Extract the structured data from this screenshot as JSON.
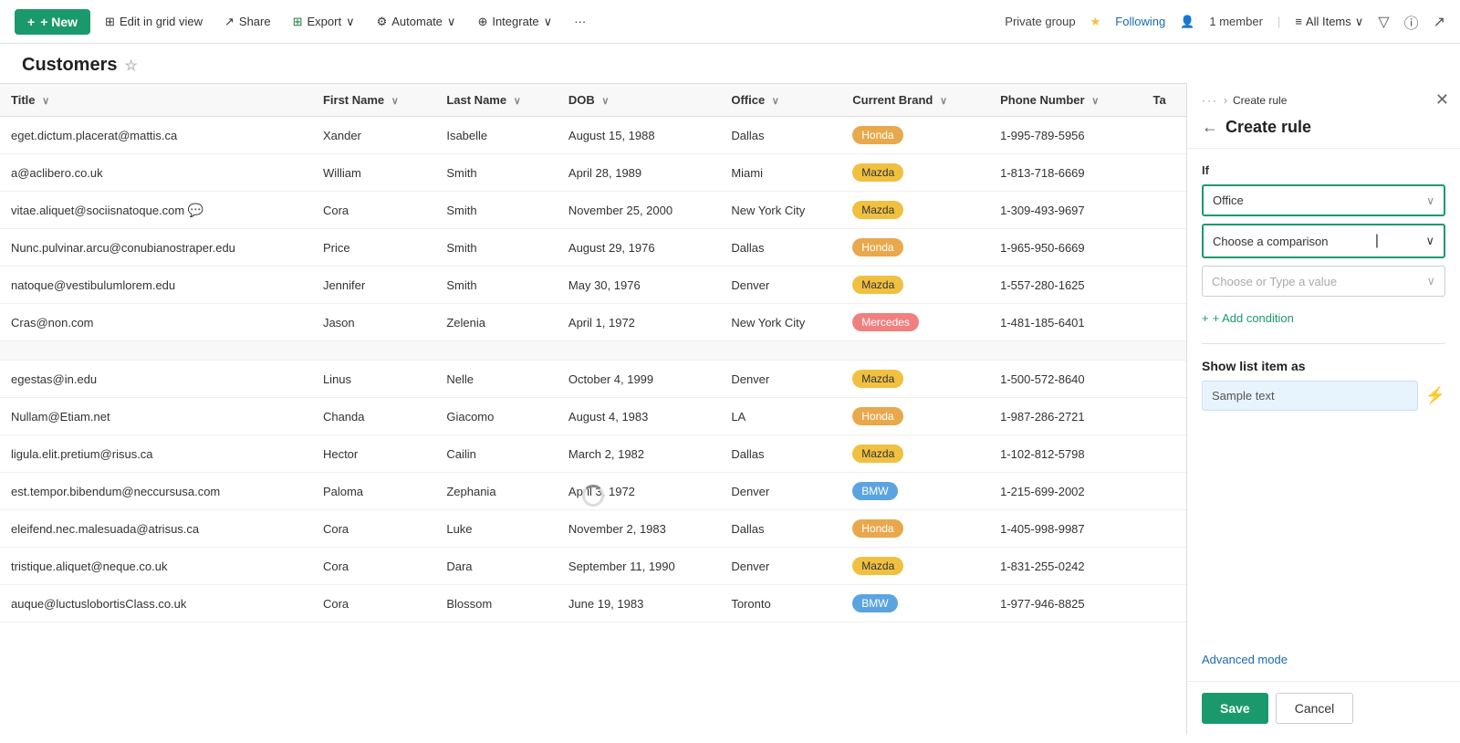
{
  "topbar": {
    "new_label": "+ New",
    "edit_grid_label": "Edit in grid view",
    "share_label": "Share",
    "export_label": "Export",
    "automate_label": "Automate",
    "integrate_label": "Integrate",
    "more_label": "···",
    "private_group_label": "Private group",
    "following_label": "Following",
    "member_label": "1 member",
    "all_items_label": "All Items",
    "filter_icon": "≡"
  },
  "page": {
    "title": "Customers"
  },
  "table": {
    "columns": [
      "Title",
      "First Name",
      "Last Name",
      "DOB",
      "Office",
      "Current Brand",
      "Phone Number",
      "Ta"
    ],
    "rows": [
      {
        "title": "eget.dictum.placerat@mattis.ca",
        "first_name": "Xander",
        "last_name": "Isabelle",
        "dob": "August 15, 1988",
        "office": "Dallas",
        "brand": "Honda",
        "brand_class": "brand-honda",
        "phone": "1-995-789-5956",
        "has_chat": false
      },
      {
        "title": "a@aclibero.co.uk",
        "first_name": "William",
        "last_name": "Smith",
        "dob": "April 28, 1989",
        "office": "Miami",
        "brand": "Mazda",
        "brand_class": "brand-mazda",
        "phone": "1-813-718-6669",
        "has_chat": false
      },
      {
        "title": "vitae.aliquet@sociisnatoque.com",
        "first_name": "Cora",
        "last_name": "Smith",
        "dob": "November 25, 2000",
        "office": "New York City",
        "brand": "Mazda",
        "brand_class": "brand-mazda",
        "phone": "1-309-493-9697",
        "has_chat": true
      },
      {
        "title": "Nunc.pulvinar.arcu@conubianostraper.edu",
        "first_name": "Price",
        "last_name": "Smith",
        "dob": "August 29, 1976",
        "office": "Dallas",
        "brand": "Honda",
        "brand_class": "brand-honda",
        "phone": "1-965-950-6669",
        "has_chat": false
      },
      {
        "title": "natoque@vestibulumlorem.edu",
        "first_name": "Jennifer",
        "last_name": "Smith",
        "dob": "May 30, 1976",
        "office": "Denver",
        "brand": "Mazda",
        "brand_class": "brand-mazda",
        "phone": "1-557-280-1625",
        "has_chat": false
      },
      {
        "title": "Cras@non.com",
        "first_name": "Jason",
        "last_name": "Zelenia",
        "dob": "April 1, 1972",
        "office": "New York City",
        "brand": "Mercedes",
        "brand_class": "brand-mercedes",
        "phone": "1-481-185-6401",
        "has_chat": false
      },
      {
        "separator": true
      },
      {
        "title": "egestas@in.edu",
        "first_name": "Linus",
        "last_name": "Nelle",
        "dob": "October 4, 1999",
        "office": "Denver",
        "brand": "Mazda",
        "brand_class": "brand-mazda",
        "phone": "1-500-572-8640",
        "has_chat": false
      },
      {
        "title": "Nullam@Etiam.net",
        "first_name": "Chanda",
        "last_name": "Giacomo",
        "dob": "August 4, 1983",
        "office": "LA",
        "brand": "Honda",
        "brand_class": "brand-honda",
        "phone": "1-987-286-2721",
        "has_chat": false
      },
      {
        "title": "ligula.elit.pretium@risus.ca",
        "first_name": "Hector",
        "last_name": "Cailin",
        "dob": "March 2, 1982",
        "office": "Dallas",
        "brand": "Mazda",
        "brand_class": "brand-mazda",
        "phone": "1-102-812-5798",
        "has_chat": false
      },
      {
        "title": "est.tempor.bibendum@neccursusa.com",
        "first_name": "Paloma",
        "last_name": "Zephania",
        "dob": "April 3, 1972",
        "office": "Denver",
        "brand": "BMW",
        "brand_class": "brand-bmw",
        "phone": "1-215-699-2002",
        "has_chat": false
      },
      {
        "title": "eleifend.nec.malesuada@atrisus.ca",
        "first_name": "Cora",
        "last_name": "Luke",
        "dob": "November 2, 1983",
        "office": "Dallas",
        "brand": "Honda",
        "brand_class": "brand-honda",
        "phone": "1-405-998-9987",
        "has_chat": false
      },
      {
        "title": "tristique.aliquet@neque.co.uk",
        "first_name": "Cora",
        "last_name": "Dara",
        "dob": "September 11, 1990",
        "office": "Denver",
        "brand": "Mazda",
        "brand_class": "brand-mazda",
        "phone": "1-831-255-0242",
        "has_chat": false
      },
      {
        "title": "auque@luctuslobortisClass.co.uk",
        "first_name": "Cora",
        "last_name": "Blossom",
        "dob": "June 19, 1983",
        "office": "Toronto",
        "brand": "BMW",
        "brand_class": "brand-bmw",
        "phone": "1-977-946-8825",
        "has_chat": false
      }
    ]
  },
  "panel": {
    "breadcrumb_dots": "···",
    "breadcrumb_arrow": "›",
    "breadcrumb_label": "Create rule",
    "back_arrow": "←",
    "title": "Create rule",
    "close_icon": "✕",
    "if_label": "If",
    "field_selected": "Office",
    "comparison_placeholder": "Choose a comparison",
    "value_placeholder": "Choose or Type a value",
    "add_condition_label": "+ Add condition",
    "show_list_label": "Show list item as",
    "sample_text": "Sample text",
    "format_icon": "⚡",
    "advanced_mode_label": "Advanced mode",
    "save_label": "Save",
    "cancel_label": "Cancel"
  }
}
